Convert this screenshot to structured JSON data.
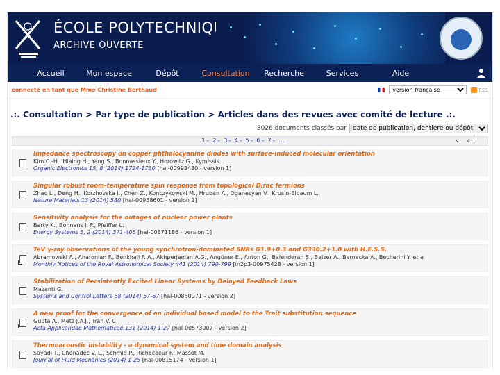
{
  "header": {
    "school": "ÉCOLE POLYTECHNIQUE",
    "archive": "ARCHIVE OUVERTE"
  },
  "nav": {
    "items": [
      "Accueil",
      "Mon espace",
      "Dépôt",
      "Consultation",
      "Recherche",
      "Services",
      "Aide"
    ],
    "active": "Consultation"
  },
  "subbar": {
    "connected": "connecté en tant que Mme Christine Berthaud",
    "language": "version française",
    "rss": "RSS"
  },
  "breadcrumb": ".:. Consultation > Par type de publication > Articles dans des revues avec comité de lecture .:.",
  "listing": {
    "count": "8026 documents classés par",
    "sort": "date de publication, dentiere ou dépôt",
    "pages": [
      "1",
      "2",
      "3",
      "4",
      "5",
      "6",
      "7",
      "..."
    ],
    "current_page": "1",
    "arrows": "» »|"
  },
  "articles": [
    {
      "title": "Impedance spectroscopy on copper phthalocyanine diodes with surface-induced molecular orientation",
      "authors": "Kim C.-H., Hlaing H., Yang S., Bonnassieux Y., Horowitz G., Kymissis I.",
      "journal": "Organic Electronics 15, 8 (2014) 1724-1730",
      "hal": "[hal-00993430 - version 1]",
      "icon": "document-icon"
    },
    {
      "title": "Singular robust room-temperature spin response from topological Dirac fermions",
      "authors": "Zhao L., Deng H., Korzhovska I., Chen Z., Konczykowski M., Hruban A., Oganesyan V., Krusin-Elbaum L.",
      "journal": "Nature Materials 13 (2014) 580",
      "hal": "[hal-00958601 - version 1]",
      "icon": "document-icon"
    },
    {
      "title": "Sensitivity analysis for the outages of nuclear power plants",
      "authors": "Barty K., Bonnans J. F., Pfeiffer L.",
      "journal": "Energy Systems 5, 2 (2014) 371-406",
      "hal": "[hal-00671186 - version 1]",
      "icon": "document-icon"
    },
    {
      "title": "TeV γ-ray observations of the young synchrotron-dominated SNRs G1.9+0.3 and G330.2+1.0 with H.E.S.S.",
      "authors": "Abramowski A., Aharonian F., Benkhali F. A., Akhperjanian A.G., Angüner E., Anton G., Balenderan S., Balzer A., Barnacka A., Becherini Y. et a",
      "journal": "Monthly Notices of the Royal Astronomical Society 441 (2014) 790-799",
      "hal": "[in2p3-00975428 - version 1]",
      "icon": "link-document-icon"
    },
    {
      "title": "Stabilization of Persistently Excited Linear Systems by Delayed Feedback Laws",
      "authors": "Mazanti G.",
      "journal": "Systems and Control Letters 68 (2014) 57-67",
      "hal": "[hal-00850071 - version 2]",
      "icon": "document-icon"
    },
    {
      "title": "A new proof for the convergence of an individual based model to the Trait substitution sequence",
      "authors": "Gupta A., Metz J.A.J., Tran V. C.",
      "journal": "Acta Applicandae Mathematicae 131 (2014) 1-27",
      "hal": "[hal-00573007 - version 2]",
      "icon": "link-document-icon"
    },
    {
      "title": "Thermoacoustic instability - a dynamical system and time domain analysis",
      "authors": "Sayadi T., Chenadec V. L., Schmid P., Richecoeur F., Massot M.",
      "journal": "Journal of Fluid Mechanics (2014) 1-25",
      "hal": "[hal-00815174 - version 1]",
      "icon": "document-icon"
    }
  ]
}
